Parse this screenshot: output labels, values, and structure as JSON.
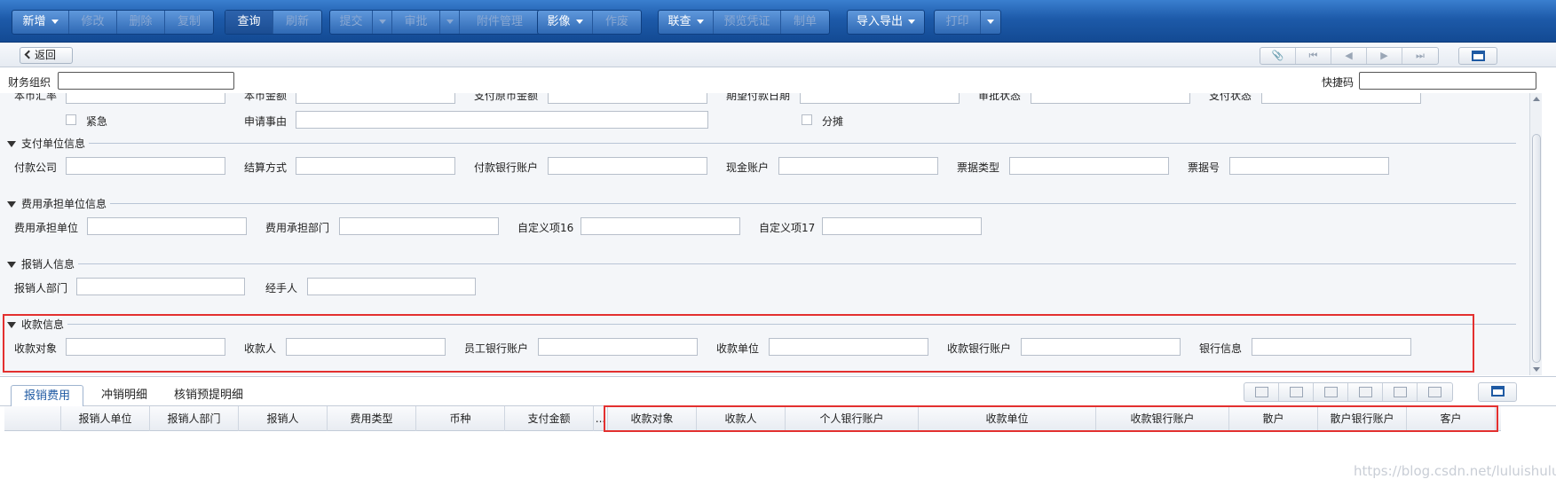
{
  "toolbar": {
    "add": "新增",
    "edit": "修改",
    "delete": "删除",
    "copy": "复制",
    "query": "查询",
    "refresh": "刷新",
    "submit": "提交",
    "approve": "审批",
    "attachments": "附件管理",
    "image": "影像",
    "void": "作废",
    "linked_query": "联查",
    "preview_voucher": "预览凭证",
    "make_bill": "制单",
    "import_export": "导入导出",
    "print": "打印"
  },
  "nav": {
    "back": "返回"
  },
  "header": {
    "org_label": "财务组织",
    "org_value": "",
    "quickcode_label": "快捷码",
    "quickcode_value": ""
  },
  "basic": {
    "labels": [
      "本币汇率",
      "本币金额",
      "支付原币金额",
      "期望付款日期",
      "审批状态",
      "支付状态"
    ],
    "urgent": "紧急",
    "reason": "申请事由",
    "split": "分摊"
  },
  "sections": {
    "payer": {
      "title": "支付单位信息",
      "labels": [
        "付款公司",
        "结算方式",
        "付款银行账户",
        "现金账户",
        "票据类型",
        "票据号"
      ]
    },
    "cost": {
      "title": "费用承担单位信息",
      "labels": [
        "费用承担单位",
        "费用承担部门",
        "自定义项16",
        "自定义项17"
      ]
    },
    "claimant": {
      "title": "报销人信息",
      "labels": [
        "报销人部门",
        "经手人"
      ]
    },
    "payee": {
      "title": "收款信息",
      "labels": [
        "收款对象",
        "收款人",
        "员工银行账户",
        "收款单位",
        "收款银行账户",
        "银行信息"
      ]
    }
  },
  "tabs": [
    "报销费用",
    "冲销明细",
    "核销预提明细"
  ],
  "grid": {
    "columns": [
      "报销人单位",
      "报销人部门",
      "报销人",
      "费用类型",
      "币种",
      "支付金额",
      "...",
      "收款对象",
      "收款人",
      "个人银行账户",
      "收款单位",
      "收款银行账户",
      "散户",
      "散户银行账户",
      "客户"
    ]
  },
  "watermark": "https://blog.csdn.net/luluishuluu"
}
